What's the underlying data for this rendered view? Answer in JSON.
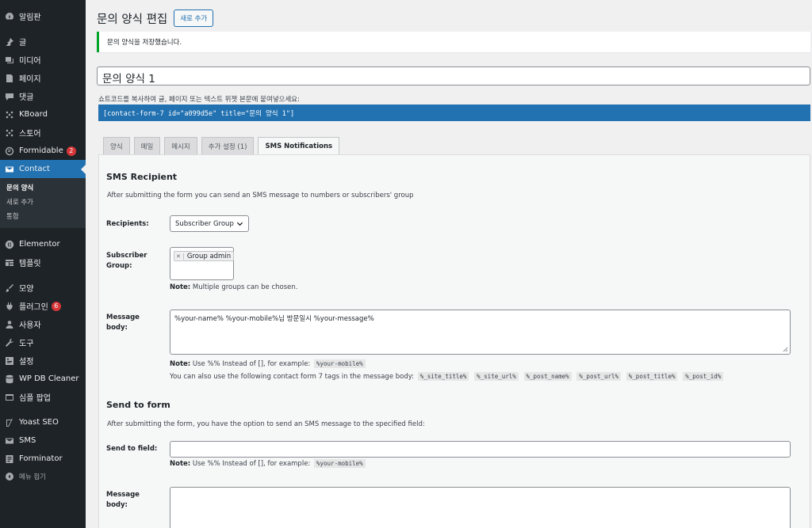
{
  "sidebar": {
    "items": [
      {
        "label": "알림판",
        "icon": "dashboard-icon"
      },
      {
        "label": "글",
        "icon": "pin-icon"
      },
      {
        "label": "미디어",
        "icon": "media-icon"
      },
      {
        "label": "페이지",
        "icon": "page-icon"
      },
      {
        "label": "댓글",
        "icon": "comment-icon"
      },
      {
        "label": "KBoard",
        "icon": "kboard-icon"
      },
      {
        "label": "스토어",
        "icon": "store-icon"
      },
      {
        "label": "Formidable",
        "icon": "formidable-icon",
        "badge": "2"
      },
      {
        "label": "Contact",
        "icon": "mail-icon"
      }
    ],
    "submenu": [
      {
        "label": "문의 양식"
      },
      {
        "label": "새로 추가"
      },
      {
        "label": "통합"
      }
    ],
    "items2": [
      {
        "label": "Elementor",
        "icon": "elementor-icon"
      },
      {
        "label": "템플릿",
        "icon": "template-icon"
      }
    ],
    "items3": [
      {
        "label": "모양",
        "icon": "brush-icon"
      },
      {
        "label": "플러그인",
        "icon": "plugin-icon",
        "badge": "6"
      },
      {
        "label": "사용자",
        "icon": "user-icon"
      },
      {
        "label": "도구",
        "icon": "tool-icon"
      },
      {
        "label": "설정",
        "icon": "settings-icon"
      },
      {
        "label": "WP DB Cleaner",
        "icon": "db-cleaner-icon"
      },
      {
        "label": "심플 팝업",
        "icon": "popup-icon"
      }
    ],
    "items4": [
      {
        "label": "Yoast SEO",
        "icon": "yoast-icon"
      },
      {
        "label": "SMS",
        "icon": "sms-icon"
      },
      {
        "label": "Forminator",
        "icon": "forminator-icon"
      }
    ],
    "collapse_label": "메뉴 접기"
  },
  "header": {
    "title": "문의 양식 편집",
    "add_new": "새로 추가"
  },
  "notice": "문의 양식을 저장했습니다.",
  "form_title": "문의 양식 1",
  "shortcode": {
    "label": "쇼트코드를 복사하여 글, 페이지 또는 텍스트 위젯 본문에 붙여넣으세요:",
    "value": "[contact-form-7 id=\"a099d5e\" title=\"문의 양식 1\"]"
  },
  "tabs": [
    {
      "label": "양식"
    },
    {
      "label": "메일"
    },
    {
      "label": "메시지"
    },
    {
      "label": "추가 설정 (1)"
    },
    {
      "label": "SMS Notifications"
    }
  ],
  "sms_recipient": {
    "title": "SMS Recipient",
    "description": "After submitting the form you can send an SMS message to numbers or subscribers' group",
    "recipients_label": "Recipients:",
    "recipients_value": "Subscriber Group",
    "group_label": "Subscriber Group:",
    "group_chip": "Group admin",
    "group_note_bold": "Note:",
    "group_note": " Multiple groups can be chosen.",
    "message_label": "Message body:",
    "message_value": "%your-name% %your-mobile%님 방문일시 %your-message%",
    "note1_bold": "Note:",
    "note1_text": " Use %% Instead of [], for example: ",
    "note1_code": "%your-mobile%",
    "note2_text": "You can also use the following contact form 7 tags in the message body:",
    "tags": [
      "%_site_title%",
      "%_site_url%",
      "%_post_name%",
      "%_post_url%",
      "%_post_title%",
      "%_post_id%"
    ]
  },
  "send_to_form": {
    "title": "Send to form",
    "description": "After submitting the form, you have the option to send an SMS message to the specified field:",
    "field_label": "Send to field:",
    "note_bold": "Note:",
    "note_text": " Use %% Instead of [], for example: ",
    "note_code": "%your-mobile%",
    "message_label": "Message body:"
  },
  "colors": {
    "sidebar_bg": "#1d2327",
    "accent": "#2271b1",
    "success": "#00a32a",
    "badge": "#d63638"
  }
}
